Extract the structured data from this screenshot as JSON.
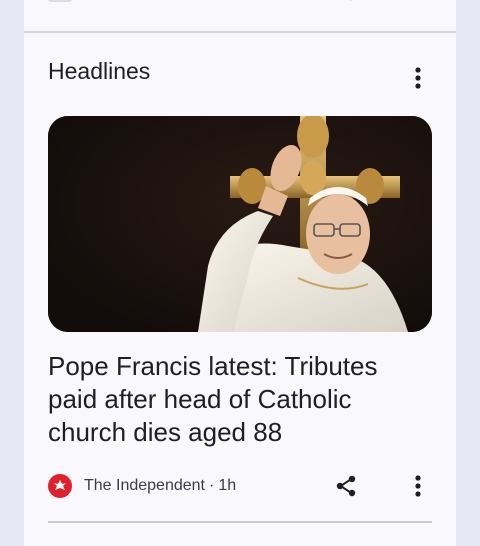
{
  "section": {
    "title": "Headlines",
    "menu_icon": "more-vert-icon"
  },
  "story": {
    "image_description_icon": "news-photo",
    "headline": "Pope Francis latest: Tributes paid after head of Catholic church dies aged 88",
    "source": "The Independent",
    "separator": "·",
    "age": "1h",
    "share_icon": "share-icon",
    "menu_icon": "more-vert-icon",
    "source_logo_icon": "eagle-logo-icon",
    "source_logo_color": "#e0202a"
  }
}
